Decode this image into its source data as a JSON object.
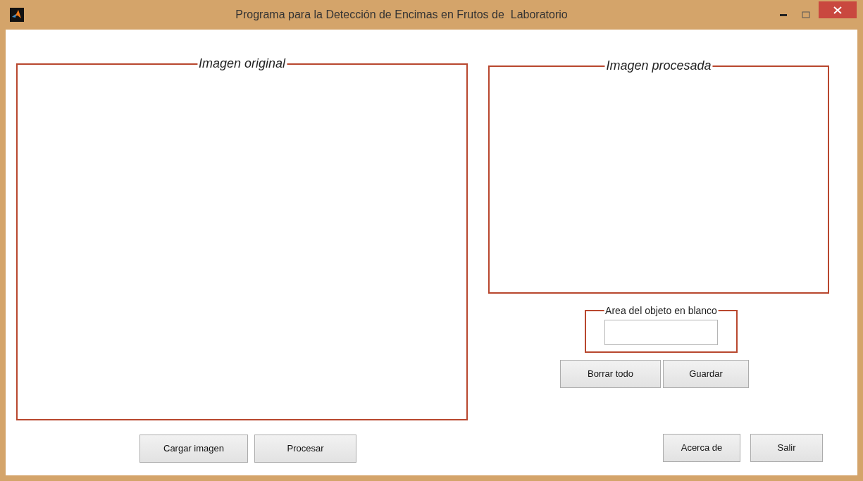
{
  "window": {
    "title": "Programa para la Detección de Encimas en Frutos de  Laboratorio"
  },
  "original_panel": {
    "title": "Imagen original"
  },
  "image_buttons": [
    "Cargar imagen",
    "Procesar"
  ],
  "processed_panel": {
    "title": "Imagen procesada"
  },
  "area_group": {
    "label": "Area del objeto en blanco"
  },
  "edit_buttons": [
    "Borrar todo",
    "Guardar"
  ],
  "footer_buttons": [
    "Acerca de",
    "Salir"
  ]
}
